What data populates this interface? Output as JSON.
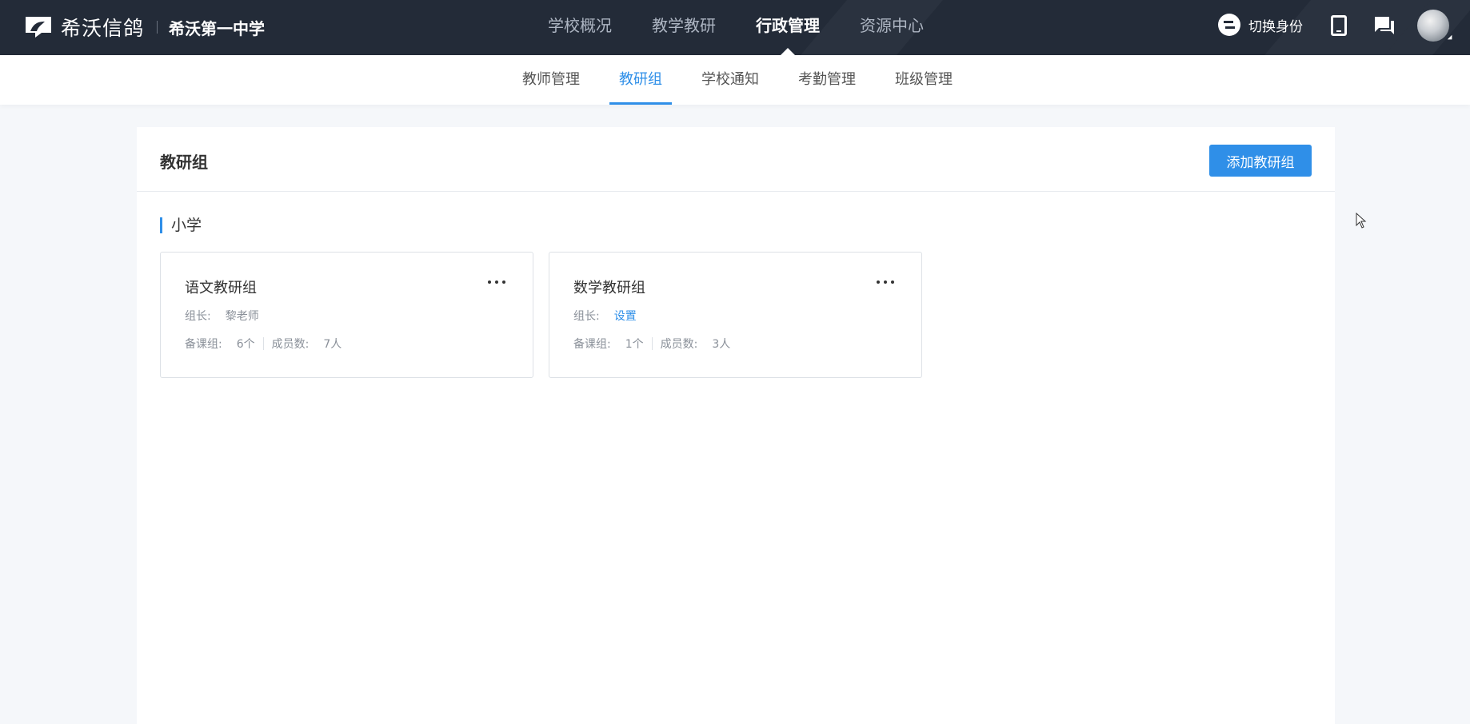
{
  "brand": {
    "name": "希沃信鸽",
    "school": "希沃第一中学"
  },
  "main_nav": [
    {
      "label": "学校概况"
    },
    {
      "label": "教学教研"
    },
    {
      "label": "行政管理"
    },
    {
      "label": "资源中心"
    }
  ],
  "main_nav_active": "行政管理",
  "top_right": {
    "switch_identity_label": "切换身份"
  },
  "sub_nav": [
    {
      "label": "教师管理"
    },
    {
      "label": "教研组"
    },
    {
      "label": "学校通知"
    },
    {
      "label": "考勤管理"
    },
    {
      "label": "班级管理"
    }
  ],
  "sub_nav_active": "教研组",
  "panel": {
    "title": "教研组",
    "add_button_label": "添加教研组",
    "section_title": "小学"
  },
  "groups": [
    {
      "name": "语文教研组",
      "leader_label": "组长:",
      "leader_value": "黎老师",
      "prep_label": "备课组:",
      "prep_value": "6个",
      "members_label": "成员数:",
      "members_value": "7人"
    },
    {
      "name": "数学教研组",
      "leader_label": "组长:",
      "leader_value": "设置",
      "prep_label": "备课组:",
      "prep_value": "1个",
      "members_label": "成员数:",
      "members_value": "3人"
    }
  ],
  "colors": {
    "accent": "#2f8fe8",
    "topbar": "#232b38",
    "page_bg": "#f5f7fa"
  }
}
